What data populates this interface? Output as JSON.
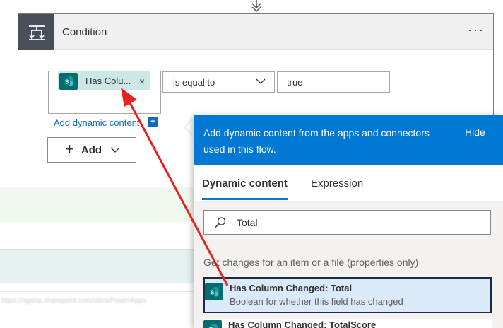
{
  "card": {
    "title": "Condition",
    "more_label": "···",
    "token_label": "Has Colu...",
    "token_close": "×",
    "operator": "is equal to",
    "value": "true",
    "add_dynamic_content": "Add dynamic content",
    "add_dynamic_plus": "+",
    "add_button": "Add"
  },
  "panel": {
    "header_text": "Add dynamic content from the apps and connectors used in this flow.",
    "hide": "Hide",
    "tabs": [
      {
        "label": "Dynamic content",
        "active": true
      },
      {
        "label": "Expression",
        "active": false
      }
    ],
    "search_value": "Total",
    "section_label": "Get changes for an item or a file (properties only)",
    "results": [
      {
        "title": "Has Column Changed: Total",
        "description": "Boolean for whether this field has changed"
      },
      {
        "title": "Has Column Changed: TotalScore",
        "description": ""
      }
    ]
  },
  "colors": {
    "accent": "#0078d4",
    "token_bg": "#cde6e6",
    "sharepoint_icon": "#036c70",
    "annotation_arrow": "#e8211d"
  },
  "icons": {
    "header": "condition-icon",
    "token": "sharepoint-icon",
    "search": "search-icon"
  }
}
